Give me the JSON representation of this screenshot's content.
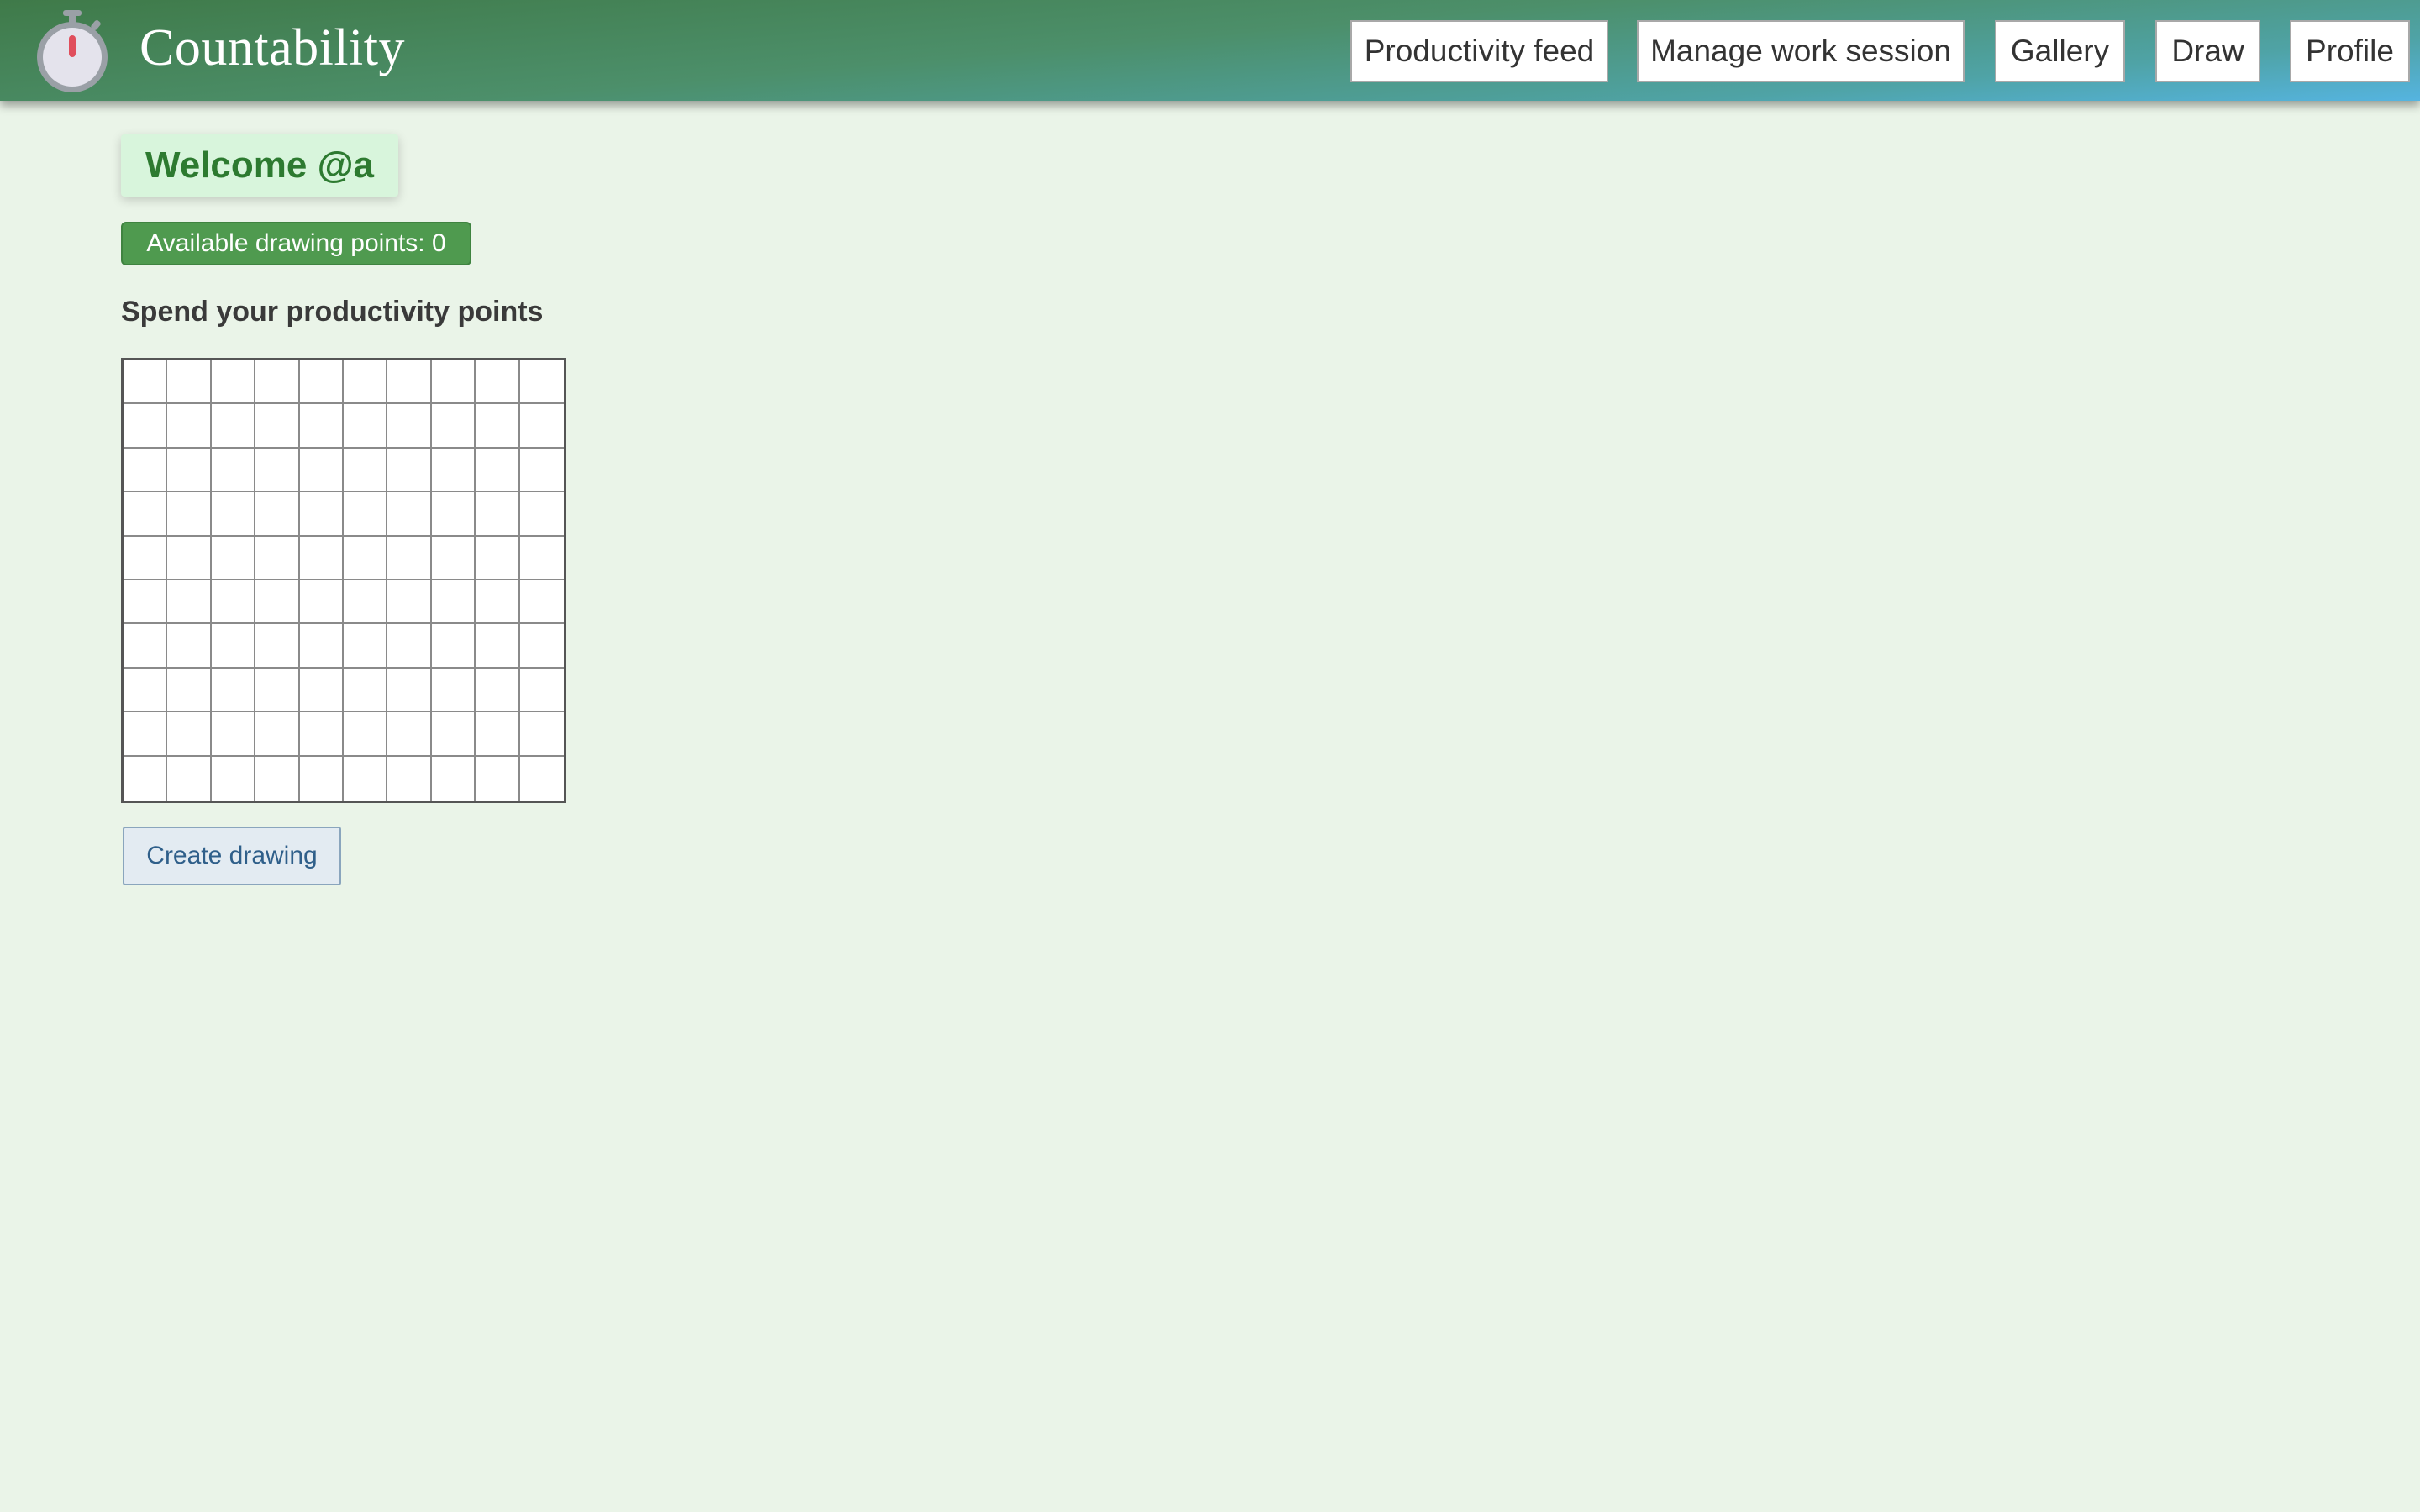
{
  "app": {
    "brand_name": "Countability",
    "logo_icon": "stopwatch-icon"
  },
  "nav": {
    "items": [
      {
        "id": "feed",
        "label": "Productivity feed"
      },
      {
        "id": "session",
        "label": "Manage work session"
      },
      {
        "id": "gallery",
        "label": "Gallery"
      },
      {
        "id": "draw",
        "label": "Draw"
      },
      {
        "id": "profile",
        "label": "Profile"
      }
    ]
  },
  "main": {
    "welcome": "Welcome @a",
    "points_badge": "Available drawing points: 0",
    "section_heading": "Spend your productivity points",
    "grid": {
      "rows": 10,
      "columns": 10
    },
    "create_button": "Create drawing"
  },
  "colors": {
    "page_background": "#eaf4e8",
    "header_gradient_start": "#3f7a49",
    "header_gradient_end": "#55b4e0",
    "welcome_text": "#2d7a30",
    "badge_background": "#4f9a4f",
    "stopwatch_accent": "#e04e5c"
  }
}
